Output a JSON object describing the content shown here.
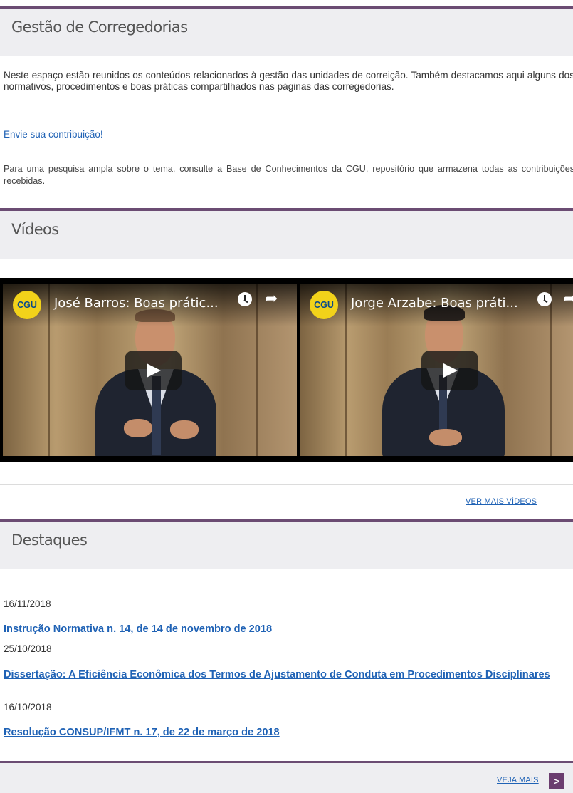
{
  "header": {
    "title": "Gestão de Corregedorias"
  },
  "intro": {
    "paragraph": "Neste espaço estão reunidos os conteúdos relacionados à gestão das unidades de correição. Também destacamos aqui alguns dos normativos, procedimentos e boas práticas compartilhados nas páginas das corregedorias.",
    "contribute_link": "Envie sua contribuição!",
    "knowledge_base_text": "Para uma pesquisa ampla sobre o tema, consulte a Base de Conhecimentos da CGU, repositório que armazena todas as contribuições recebidas."
  },
  "videos": {
    "title": "Vídeos",
    "items": [
      {
        "logo": "CGU",
        "title": "José Barros: Boas prátic...",
        "icons": [
          "clock-icon",
          "share-icon",
          "play-icon"
        ]
      },
      {
        "logo": "CGU",
        "title": "Jorge Arzabe: Boas práti...",
        "icons": [
          "clock-icon",
          "share-icon",
          "play-icon"
        ]
      }
    ],
    "more_label": "VER MAIS VÍDEOS"
  },
  "highlights": {
    "title": "Destaques",
    "items": [
      {
        "date": "16/11/2018",
        "title": "Instrução Normativa n. 14, de 14 de novembro de 2018"
      },
      {
        "date": "25/10/2018",
        "title": "Dissertação: A Eficiência Econômica dos Termos de Ajustamento de Conduta em Procedimentos Disciplinares"
      },
      {
        "date": "16/10/2018",
        "title": "Resolução CONSUP/IFMT n. 17, de 22 de março de 2018"
      }
    ],
    "more_label": "VEJA MAIS",
    "more_icon": "arrow-right-icon"
  },
  "colors": {
    "accent": "#6b4c73",
    "link": "#1f62b5",
    "header_bg": "#eeeef1"
  }
}
